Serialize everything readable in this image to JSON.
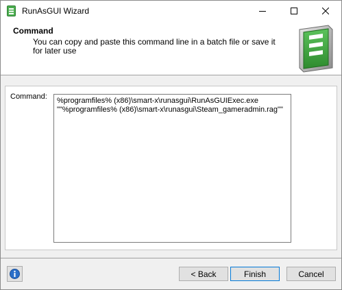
{
  "window": {
    "title": "RunAsGUI Wizard"
  },
  "header": {
    "title": "Command",
    "description": "You can copy and paste this command line in a batch file or save it for later use"
  },
  "panel": {
    "command_label": "Command:",
    "command_text": "%programfiles% (x86)\\smart-x\\runasgui\\RunAsGUIExec.exe \"\"%programfiles% (x86)\\smart-x\\runasgui\\Steam_gameradmin.rag\"\""
  },
  "buttons": {
    "back": "< Back",
    "finish": "Finish",
    "cancel": "Cancel"
  },
  "icons": {
    "app": "app-icon",
    "info": "info-icon",
    "logo": "wizard-logo-icon"
  },
  "colors": {
    "accent": "#0078d7",
    "brand_green": "#3a9a3a"
  }
}
